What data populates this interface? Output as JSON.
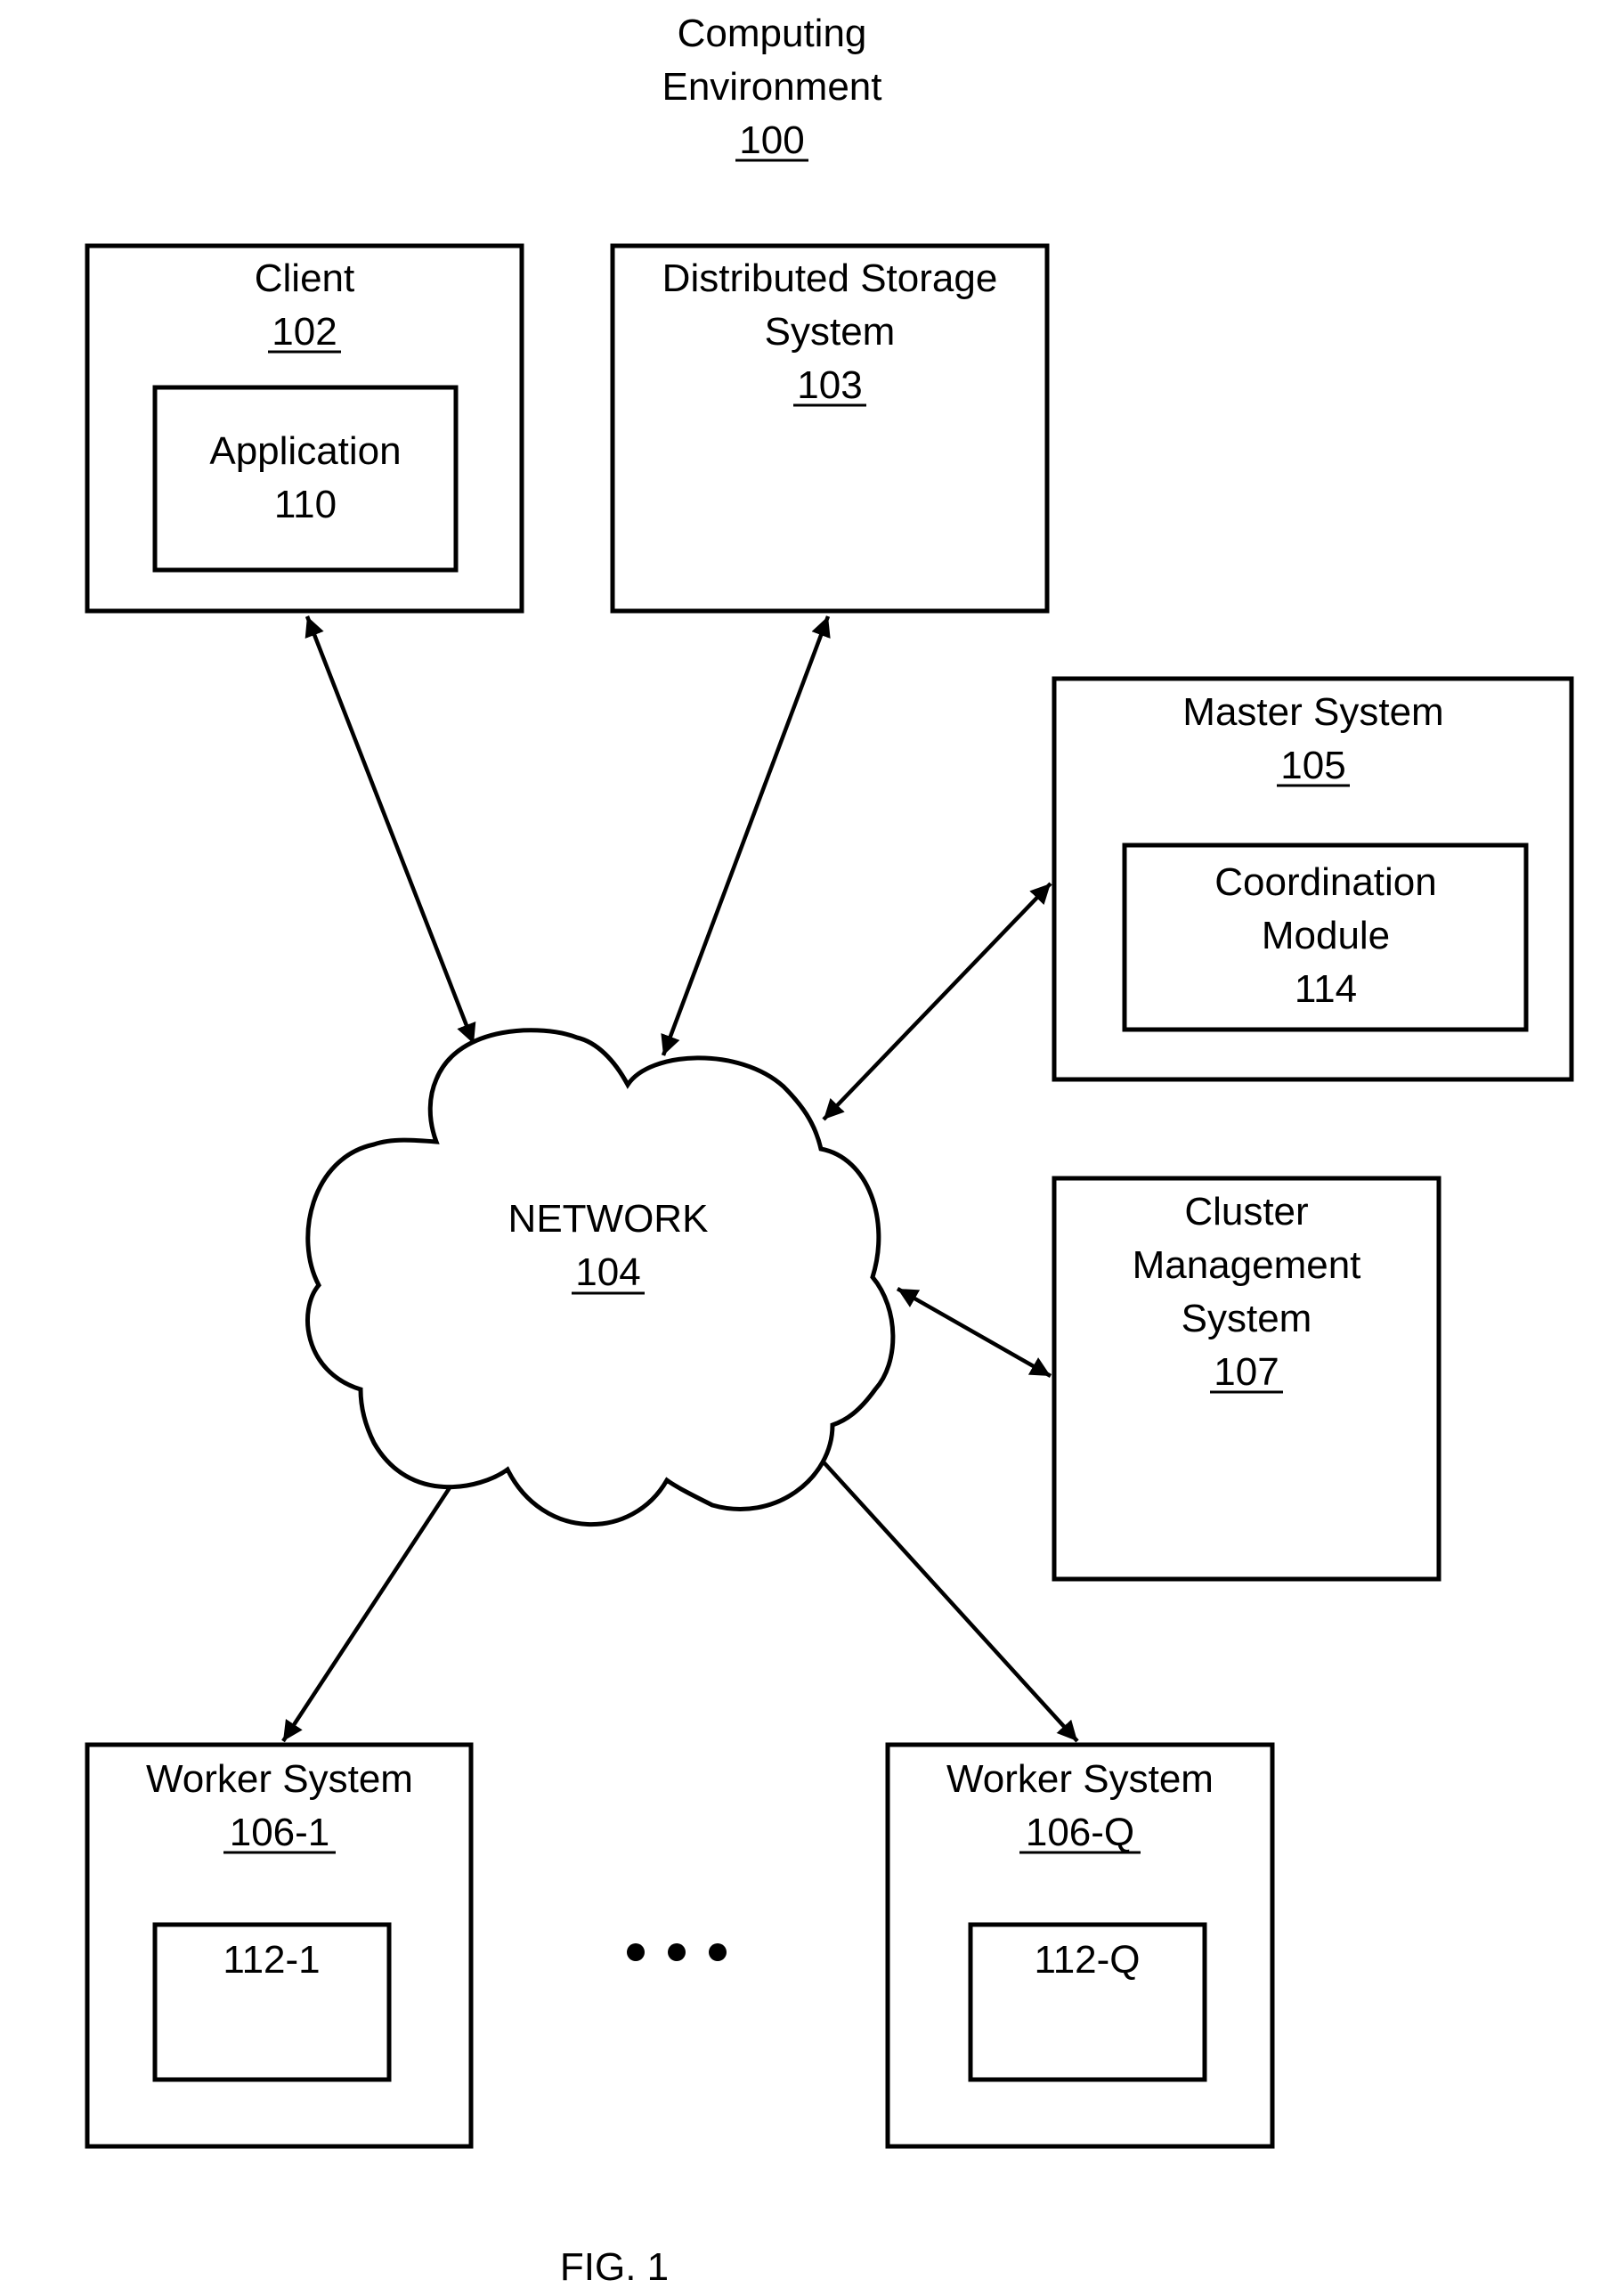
{
  "figure": {
    "title_lines": [
      "Computing",
      "Environment"
    ],
    "title_ref": "100",
    "caption": "FIG. 1"
  },
  "nodes": {
    "client": {
      "label": "Client",
      "ref": "102"
    },
    "application": {
      "label": "Application",
      "ref": "110"
    },
    "storage": {
      "label_lines": [
        "Distributed Storage",
        "System"
      ],
      "ref": "103"
    },
    "network": {
      "label": "NETWORK",
      "ref": "104"
    },
    "master": {
      "label": "Master System",
      "ref": "105"
    },
    "coordination": {
      "label_lines": [
        "Coordination",
        "Module"
      ],
      "ref": "114"
    },
    "cluster": {
      "label_lines": [
        "Cluster",
        "Management",
        "System"
      ],
      "ref": "107"
    },
    "worker1": {
      "label": "Worker System",
      "ref": "106-1",
      "inner": "112-1"
    },
    "workerQ": {
      "label": "Worker System",
      "ref": "106-Q",
      "inner": "112-Q"
    }
  },
  "connections": [
    {
      "from": "client",
      "to": "network",
      "type": "bidirectional"
    },
    {
      "from": "storage",
      "to": "network",
      "type": "bidirectional"
    },
    {
      "from": "master",
      "to": "network",
      "type": "bidirectional"
    },
    {
      "from": "cluster",
      "to": "network",
      "type": "bidirectional"
    },
    {
      "from": "worker1",
      "to": "network",
      "type": "bidirectional"
    },
    {
      "from": "workerQ",
      "to": "network",
      "type": "bidirectional"
    }
  ],
  "ellipsis": "•••"
}
